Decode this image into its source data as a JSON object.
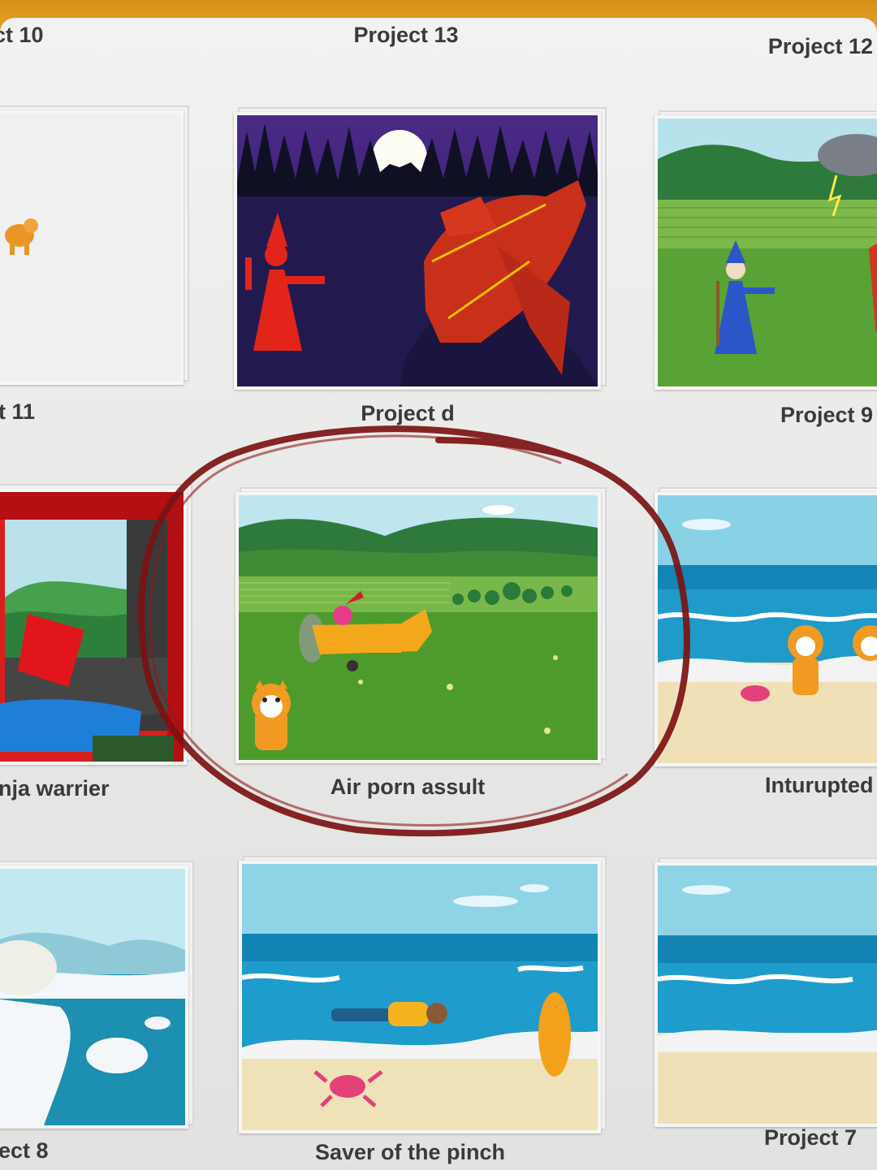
{
  "projects": [
    {
      "title": "ct 10"
    },
    {
      "title": "Project 13"
    },
    {
      "title": "Project 12"
    },
    {
      "title": "t 11"
    },
    {
      "title": "Project d"
    },
    {
      "title": "Project 9"
    },
    {
      "title": "nja warrier"
    },
    {
      "title": "Air porn assult"
    },
    {
      "title": "Inturupted"
    },
    {
      "title": "ect 8"
    },
    {
      "title": "Saver of the pinch"
    },
    {
      "title": "Project 7"
    }
  ],
  "annotation": {
    "color": "#7b1212",
    "circled_project": "Air porn assult"
  },
  "colors": {
    "top_bar": "#e29d22",
    "background": "#e9e9e7",
    "label_text": "#3a3a3a"
  }
}
